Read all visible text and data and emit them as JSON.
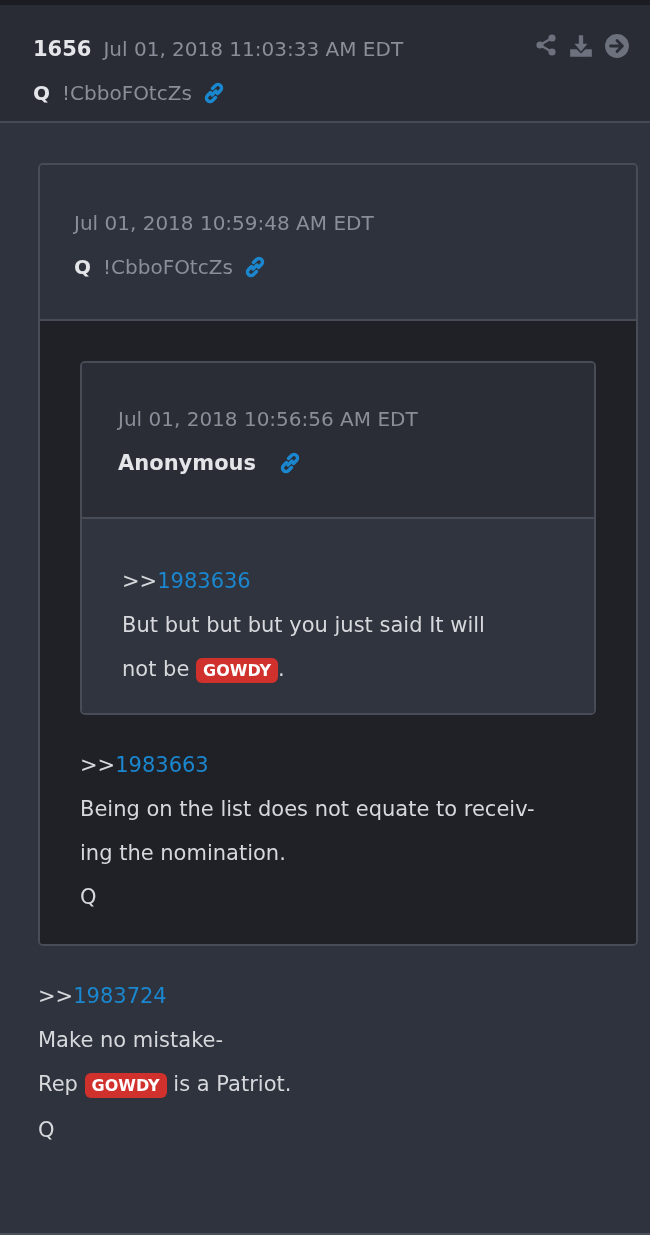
{
  "post": {
    "number": "1656",
    "date": "Jul 01, 2018 11:03:33 AM EDT",
    "author": "Q",
    "tripcode": "!CbboFOtcZs"
  },
  "quote": {
    "date": "Jul 01, 2018 10:59:48 AM EDT",
    "author": "Q",
    "tripcode": "!CbboFOtcZs",
    "quote": {
      "date": "Jul 01, 2018 10:56:56 AM EDT",
      "author": "Anonymous",
      "lines": [
        [
          {
            "kind": "text",
            "text": ">>"
          },
          {
            "kind": "ref",
            "text": "1983636"
          }
        ],
        [
          {
            "kind": "text",
            "text": "But but but but you just said It will"
          }
        ],
        [
          {
            "kind": "text",
            "text": "not be "
          },
          {
            "kind": "tag",
            "text": "GOWDY"
          },
          {
            "kind": "text",
            "text": "."
          }
        ]
      ]
    },
    "lines": [
      [
        {
          "kind": "text",
          "text": ">>"
        },
        {
          "kind": "ref",
          "text": "1983663"
        }
      ],
      [
        {
          "kind": "text",
          "text": "Being on the list does not equate to receiv-"
        }
      ],
      [
        {
          "kind": "text",
          "text": "ing the nomination."
        }
      ],
      [
        {
          "kind": "text",
          "text": "Q"
        }
      ]
    ]
  },
  "lines": [
    [
      {
        "kind": "text",
        "text": ">>"
      },
      {
        "kind": "ref",
        "text": "1983724"
      }
    ],
    [
      {
        "kind": "text",
        "text": "Make no mistake-"
      }
    ],
    [
      {
        "kind": "text",
        "text": "Rep "
      },
      {
        "kind": "tag",
        "text": "GOWDY"
      },
      {
        "kind": "text",
        "text": " is a Patriot."
      }
    ],
    [
      {
        "kind": "text",
        "text": "Q"
      }
    ]
  ]
}
